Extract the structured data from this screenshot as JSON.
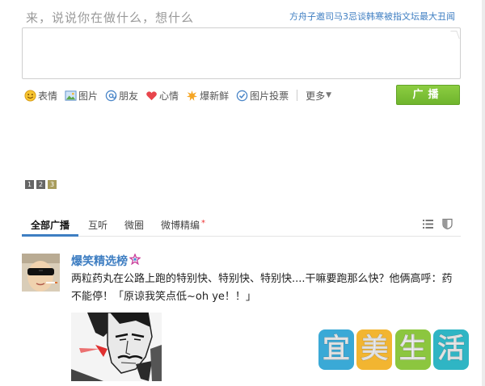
{
  "composer": {
    "prompt": "来，说说你在做什么，想什么",
    "hot_topic": "方舟子邀司马3忌谈韩寒被指文坛最大丑闻"
  },
  "toolbar": {
    "items": [
      {
        "label": "表情",
        "icon": "smiley-icon"
      },
      {
        "label": "图片",
        "icon": "picture-icon"
      },
      {
        "label": "朋友",
        "icon": "at-icon"
      },
      {
        "label": "心情",
        "icon": "heart-icon"
      },
      {
        "label": "爆新鲜",
        "icon": "burst-icon"
      },
      {
        "label": "图片投票",
        "icon": "vote-check-icon"
      }
    ],
    "more_label": "更多",
    "broadcast_label": "广播"
  },
  "pager": {
    "pages": [
      "1",
      "2",
      "3"
    ],
    "active": "3"
  },
  "tabs": {
    "items": [
      "全部广播",
      "互听",
      "微圈",
      "微博精编"
    ],
    "active": "全部广播",
    "new_marker": "*"
  },
  "post": {
    "author": "爆笑精选榜",
    "text": "两粒药丸在公路上跑的特别快、特别快、特别快....干嘛要跑那么快？他俩高呼：药不能停！「原谅我笑点低~oh ye！！」"
  },
  "watermark": {
    "chars": [
      "宜",
      "美",
      "生",
      "活"
    ],
    "colors": [
      "#3aa9d6",
      "#f2b531",
      "#8cc63f",
      "#2fb5c4"
    ]
  },
  "colors": {
    "link": "#3e7ec2",
    "accent_green": "#7abd35"
  }
}
